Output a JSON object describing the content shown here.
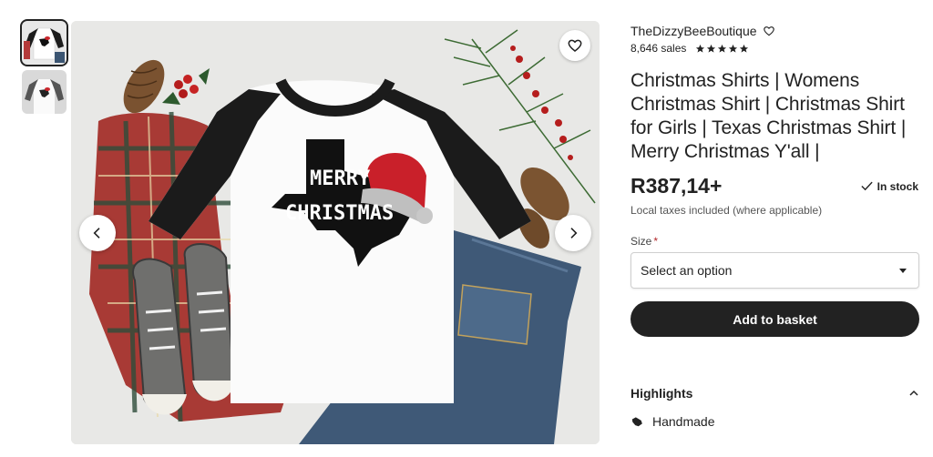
{
  "gallery": {
    "thumbnails": [
      {
        "label": "",
        "active": true
      },
      {
        "label": "",
        "active": false
      }
    ],
    "main_image_text": [
      "MERRY",
      "CHRISTMAS"
    ],
    "icons": {
      "favorite": "heart-icon",
      "prev": "chevron-left-icon",
      "next": "chevron-right-icon"
    }
  },
  "product": {
    "shop_name": "TheDizzyBeeBoutique",
    "sales": "8,646 sales",
    "rating_stars": 5,
    "title": "Christmas Shirts | Womens Christmas Shirt | Christmas Shirt for Girls | Texas Christmas Shirt | Merry Christmas Y'all |",
    "price": "R387,14+",
    "stock_status": "In stock",
    "taxes_note": "Local taxes included (where applicable)",
    "size_label": "Size",
    "size_required_mark": "*",
    "size_select_value": "Select an option",
    "add_to_basket": "Add to basket",
    "highlights_label": "Highlights",
    "highlight_items": [
      "Handmade"
    ]
  },
  "colors": {
    "accent_dark": "#222222",
    "required": "#b2262a"
  }
}
